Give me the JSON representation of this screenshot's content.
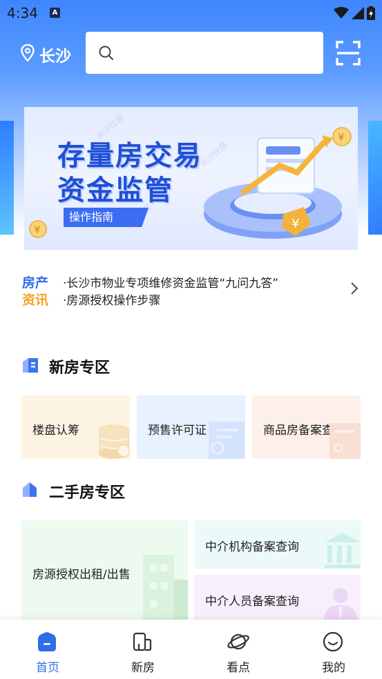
{
  "status_bar": {
    "time": "4:34",
    "notification_icon": "a-icon",
    "icons": [
      "wifi-icon",
      "signal-icon",
      "battery-icon"
    ]
  },
  "header": {
    "city": "长沙",
    "search": {
      "placeholder": ""
    }
  },
  "banner": {
    "title_line1": "存量房交易",
    "title_line2": "资金监管",
    "button": "操作指南",
    "watermark": "长沙住房"
  },
  "news": {
    "tag_line1": "房产",
    "tag_line2": "资讯",
    "items": [
      "·长沙市物业专项维修资金监管“九问九答”",
      "·房源授权操作步骤"
    ]
  },
  "new_house": {
    "title": "新房专区",
    "cards": [
      {
        "label": "楼盘认筹",
        "icon": "coin-stack-icon",
        "color": "#fdf4e4"
      },
      {
        "label": "预售许可证",
        "icon": "certificate-icon",
        "color": "#e8f1fe"
      },
      {
        "label": "商品房备案查询",
        "icon": "document-icon",
        "color": "#fdf0ea"
      }
    ]
  },
  "second_house": {
    "title": "二手房专区",
    "cards": [
      {
        "label": "房源授权出租/出售",
        "icon": "building-icon",
        "color": "#eefaf0"
      },
      {
        "label": "中介机构备案查询",
        "icon": "institution-icon",
        "color": "#ebfaf9"
      },
      {
        "label": "中介人员备案查询",
        "icon": "agent-person-icon",
        "color": "#f8effc"
      }
    ]
  },
  "bottom_nav": [
    {
      "label": "首页",
      "icon": "home-icon",
      "active": true
    },
    {
      "label": "新房",
      "icon": "new-building-icon",
      "active": false
    },
    {
      "label": "看点",
      "icon": "planet-icon",
      "active": false
    },
    {
      "label": "我的",
      "icon": "smile-icon",
      "active": false
    }
  ],
  "colors": {
    "primary": "#2f6de8",
    "accent": "#f5a524"
  }
}
